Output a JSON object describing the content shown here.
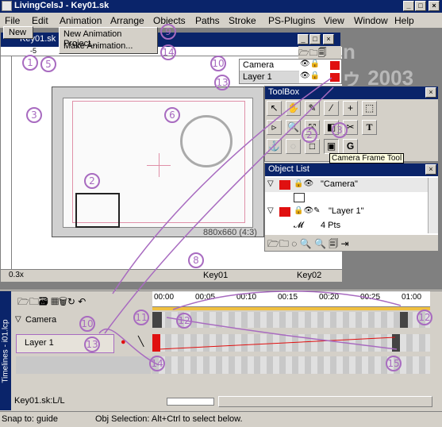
{
  "app": {
    "title": "LivingCelsJ - Key01.sk"
  },
  "menu": [
    "File",
    "Edit",
    "Animation",
    "Arrange",
    "Objects",
    "Paths",
    "Stroke",
    "PS-Plugins",
    "View",
    "Window",
    "Help"
  ],
  "file_menu": {
    "new_label": "New"
  },
  "animation_menu": {
    "new_project": "New Animation Project...",
    "make_animation": "Make Animation..."
  },
  "doc_window": {
    "title": "Key01.sk",
    "ruler_label": "-5",
    "zoom": "0.3x",
    "size_label": "880x660 (4:3)",
    "key_left": "Key01",
    "key_right": "Key02"
  },
  "bg_text": {
    "line1": "n",
    "line2": "ゥ 2003"
  },
  "layers_mini": {
    "items": [
      "Camera",
      "Layer 1"
    ]
  },
  "toolbox": {
    "title": "ToolBox",
    "tooltip": "Camera Frame Tool"
  },
  "object_list": {
    "title": "Object List",
    "items": [
      {
        "name": "\"Camera\""
      },
      {
        "name": "\"Layer 1\"",
        "pts": "4 Pts"
      }
    ]
  },
  "timeline": {
    "side_label": "Timelines - i01.lcp",
    "ticks": [
      "00:00",
      "00:05",
      "00:10",
      "00:15",
      "00:20",
      "00:25",
      "01:00"
    ],
    "rows": [
      {
        "label": "Camera"
      },
      {
        "label": "Layer 1"
      }
    ],
    "footer": "Key01.sk:L/L"
  },
  "status": {
    "left": "Snap to: guide",
    "right": "Obj Selection: Alt+Ctrl to select below."
  },
  "annotations": [
    "1",
    "2",
    "2",
    "3",
    "3",
    "5",
    "6",
    "8",
    "9",
    "10",
    "10",
    "11",
    "12",
    "12",
    "13",
    "13",
    "14",
    "15",
    "16"
  ],
  "colors": {
    "accent": "#a86bc0",
    "title": "#0a246a",
    "red": "#e01010"
  }
}
